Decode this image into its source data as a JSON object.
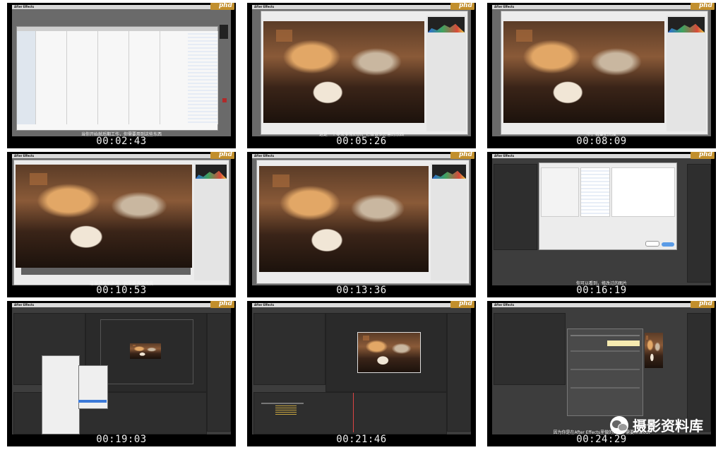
{
  "brand_label": "phd",
  "app_name": "After Effects",
  "menu_items": "File  Edit  Composition  Layer  Effect  Animation  View  Window  Help",
  "tiles": [
    {
      "time": "00:02:43",
      "subtitle": "当你开始就后期工作，你需要用到这些东西",
      "kind": "finder"
    },
    {
      "time": "00:05:26",
      "subtitle": "这是一个非常非常好的，它做很多厉害的东西",
      "kind": "camera-raw"
    },
    {
      "time": "00:08:09",
      "subtitle": "不，我要把亮度",
      "kind": "camera-raw"
    },
    {
      "time": "00:10:53",
      "subtitle": "这里没有很多光，我需要调高亮度",
      "kind": "camera-raw-wide"
    },
    {
      "time": "00:13:36",
      "subtitle": "",
      "kind": "camera-raw"
    },
    {
      "time": "00:16:19",
      "subtitle": "你可以看到，修改过的图片",
      "kind": "import-dialog"
    },
    {
      "time": "00:19:03",
      "subtitle": "",
      "kind": "ae-menu"
    },
    {
      "time": "00:21:46",
      "subtitle": "",
      "kind": "ae-comp"
    },
    {
      "time": "00:24:29",
      "subtitle": "因为你是在After Effects里做的，你不需要finalcut",
      "kind": "ae-render"
    }
  ],
  "watermark": {
    "text": "摄影资料库",
    "icon": "wechat-icon"
  },
  "colors": {
    "brand": "#c28f2c",
    "tile_bg": "#000000",
    "ae_ui": "#3d3d3d"
  }
}
